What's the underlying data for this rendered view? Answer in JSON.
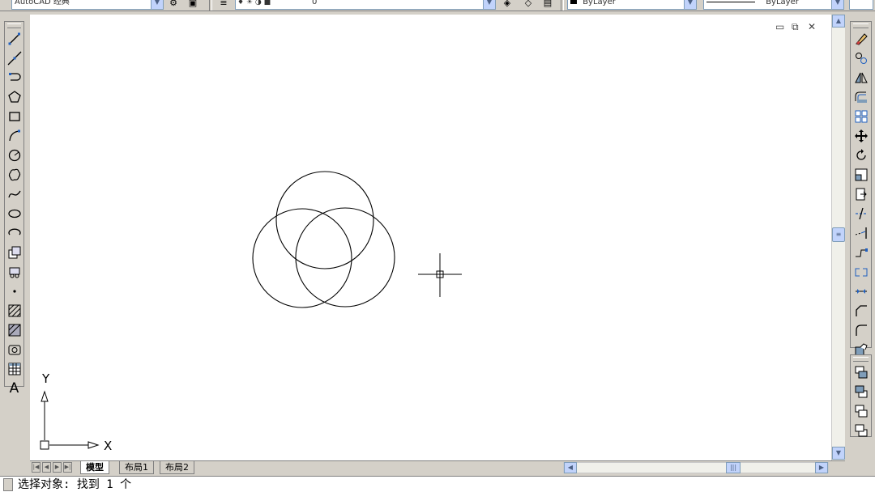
{
  "toolbar_top": {
    "workspace_combo": "AutoCAD 经典",
    "layer_value": "0",
    "color_combo": "ByLayer",
    "linetype_combo": "ByLayer"
  },
  "drawing": {
    "ucs_y_label": "Y",
    "ucs_x_label": "X",
    "window_controls": [
      "minimize",
      "restore",
      "close"
    ]
  },
  "tabs": [
    {
      "label": "模型",
      "active": true
    },
    {
      "label": "布局1",
      "active": false
    },
    {
      "label": "布局2",
      "active": false
    }
  ],
  "command_line": {
    "text": "选择对象: 找到 1 个"
  },
  "left_toolbar": {
    "tools": [
      "line-icon",
      "construction-line-icon",
      "polyline-icon",
      "polygon-icon",
      "rectangle-icon",
      "arc-icon",
      "circle-icon",
      "revision-cloud-icon",
      "spline-icon",
      "ellipse-icon",
      "ellipse-arc-icon",
      "insert-block-icon",
      "make-block-icon",
      "point-icon",
      "hatch-icon",
      "gradient-icon",
      "region-icon",
      "table-icon",
      "multiline-text-icon"
    ]
  },
  "right_toolbar": {
    "tools": [
      "erase-icon",
      "copy-icon",
      "mirror-icon",
      "offset-icon",
      "array-icon",
      "move-icon",
      "rotate-icon",
      "scale-icon",
      "stretch-icon",
      "trim-icon",
      "extend-icon",
      "break-at-point-icon",
      "break-icon",
      "join-icon",
      "chamfer-icon",
      "fillet-icon",
      "explode-icon"
    ]
  },
  "right_toolbar2": {
    "tools": [
      "bring-to-front-icon",
      "send-to-back-icon",
      "bring-above-icon",
      "send-under-icon"
    ]
  },
  "colors": {
    "ui_face": "#d4d0c8",
    "canvas": "#ffffff",
    "ink": "#000000"
  }
}
